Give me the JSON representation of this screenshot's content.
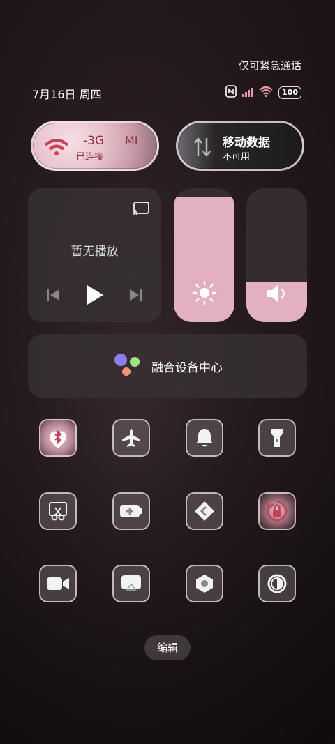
{
  "header": {
    "emergency_text": "仅可紧急通话",
    "date_text": "7月16日 周四",
    "battery_level": "100"
  },
  "pills": {
    "wifi": {
      "title": "-3G",
      "brand": "MI",
      "status": "已连接"
    },
    "mobile_data": {
      "title": "移动数据",
      "status": "不可用"
    }
  },
  "media": {
    "no_playback": "暂无播放"
  },
  "sliders": {
    "brightness_level": 0.94,
    "volume_level": 0.3
  },
  "fusion": {
    "label": "融合设备中心"
  },
  "tiles": [
    {
      "name": "bluetooth",
      "active": true
    },
    {
      "name": "airplane",
      "active": false
    },
    {
      "name": "bell",
      "active": false
    },
    {
      "name": "flashlight",
      "active": false
    },
    {
      "name": "screenshot",
      "active": false
    },
    {
      "name": "battery-saver",
      "active": false
    },
    {
      "name": "nearby-share",
      "active": false
    },
    {
      "name": "rotation-lock",
      "active": true
    },
    {
      "name": "screen-record",
      "active": false
    },
    {
      "name": "screen-cast",
      "active": false
    },
    {
      "name": "settings-hex",
      "active": false
    },
    {
      "name": "dark-mode",
      "active": false
    }
  ],
  "edit_label": "编辑",
  "colors": {
    "accent_pink": "#e2afc3",
    "active_red": "#8a2f3e"
  }
}
